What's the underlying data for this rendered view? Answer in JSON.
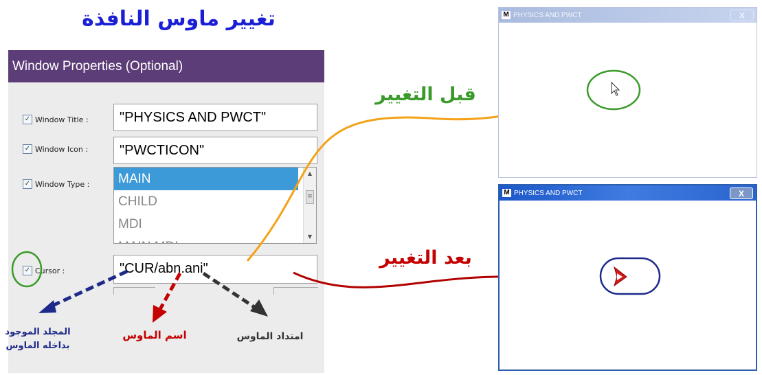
{
  "heading": "تغيير ماوس النافذة",
  "panel": {
    "header": "Window Properties (Optional)",
    "rows": [
      {
        "label": "Window Title :",
        "value": "\"PHYSICS AND PWCT\"",
        "checked": true
      },
      {
        "label": "Window Icon :",
        "value": "\"PWCTICON\"",
        "checked": true
      },
      {
        "label": "Window Type :",
        "checked": true
      },
      {
        "label": "Cursor :",
        "value": "\"CUR/abn.ani\"",
        "checked": true
      }
    ],
    "window_type_options": [
      "MAIN",
      "CHILD",
      "MDI",
      "MAIN MDI"
    ],
    "window_type_selected": "MAIN"
  },
  "annotations": {
    "before": "قبل التغيير",
    "after": "بعد التغيير",
    "folder_line1": "المجلد الموجود",
    "folder_line2": "بداخله الماوس",
    "cursor_name": "اسم الماوس",
    "cursor_ext": "امتداد الماوس"
  },
  "window_before": {
    "icon": "M",
    "title": "PHYSICS AND PWCT",
    "close": "X"
  },
  "window_after": {
    "icon": "M",
    "title": "PHYSICS AND PWCT",
    "close": "X"
  },
  "colors": {
    "header_purple": "#5d3d78",
    "heading_blue": "#1a1fd6",
    "green": "#3a9a2a",
    "red": "#c40000",
    "orange": "#f3a219",
    "navy": "#1d2a8a",
    "dark_gray": "#333333",
    "selection_blue": "#3d9ad8"
  }
}
